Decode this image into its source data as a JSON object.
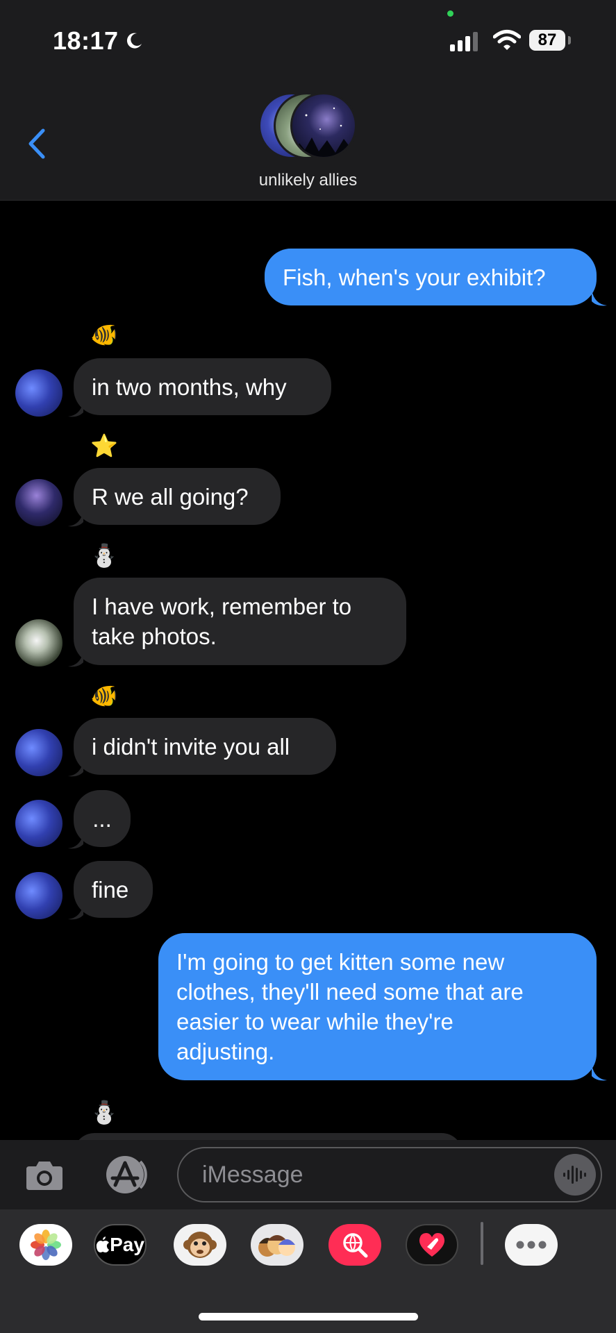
{
  "status_bar": {
    "time": "18:17",
    "battery": "87"
  },
  "conversation": {
    "name": "unlikely allies"
  },
  "messages": [
    {
      "direction": "out",
      "text": "Fish, when's your exhibit?"
    },
    {
      "direction": "in",
      "sender_icon": "🐠",
      "text": "in two months, why"
    },
    {
      "direction": "in",
      "sender_icon": "⭐",
      "text": "R we all going?"
    },
    {
      "direction": "in",
      "sender_icon": "⛄",
      "lines": [
        "I have work, remember to",
        "take photos."
      ]
    },
    {
      "direction": "in",
      "sender_icon": "🐠",
      "text": "i didn't invite you all"
    },
    {
      "direction": "in",
      "text": "..."
    },
    {
      "direction": "in",
      "text": "fine"
    },
    {
      "direction": "out",
      "lines": [
        "I'm going to get kitten some new",
        "clothes, they'll need some that are",
        "easier to wear while they're",
        "adjusting."
      ]
    },
    {
      "direction": "in",
      "sender_icon": "⛄"
    }
  ],
  "compose": {
    "placeholder": "iMessage"
  },
  "app_tray": {
    "pay_label": "Pay"
  },
  "colors": {
    "outgoing": "#3a8ff7",
    "incoming": "#262628",
    "background": "#000000",
    "accent": "#3a8ff7"
  }
}
